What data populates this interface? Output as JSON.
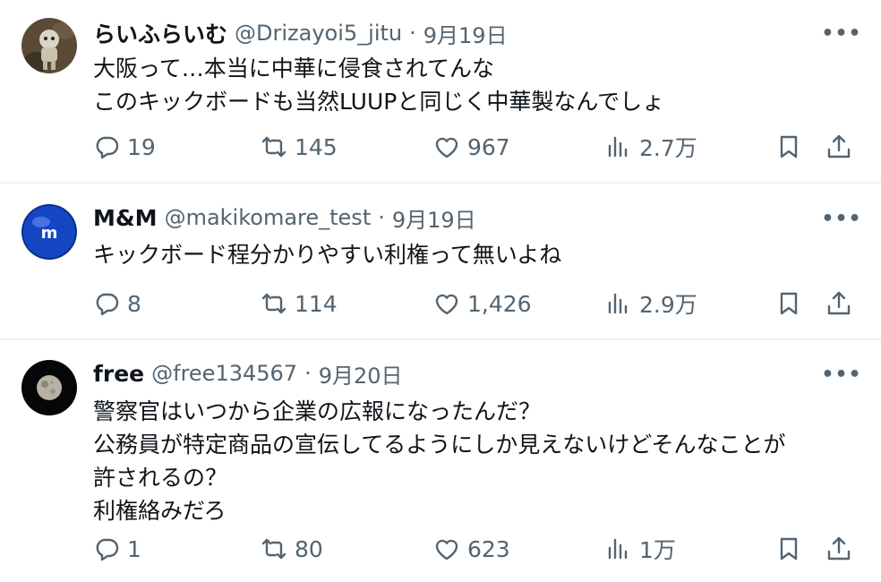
{
  "tweets": [
    {
      "display_name": "らいふらいむ",
      "handle": "@Drizayoi5_jitu",
      "date": "9月19日",
      "lines": [
        "大阪って…本当に中華に侵食されてんな",
        "このキックボードも当然LUUPと同じく中華製なんでしょ"
      ],
      "replies": "19",
      "retweets": "145",
      "likes": "967",
      "views": "2.7万"
    },
    {
      "display_name": "M&M",
      "handle": "@makikomare_test",
      "date": "9月19日",
      "lines": [
        "キックボード程分かりやすい利権って無いよね"
      ],
      "replies": "8",
      "retweets": "114",
      "likes": "1,426",
      "views": "2.9万"
    },
    {
      "display_name": "free",
      "handle": "@free134567",
      "date": "9月20日",
      "lines": [
        "警察官はいつから企業の広報になったんだ？",
        "公務員が特定商品の宣伝してるようにしか見えないけどそんなことが",
        "許されるの？",
        "利権絡みだろ"
      ],
      "replies": "1",
      "retweets": "80",
      "likes": "623",
      "views": "1万"
    }
  ],
  "separator": "·",
  "more_label": "•••",
  "colors": {
    "text": "#0f1419",
    "secondary": "#536471",
    "divider": "#eff3f4"
  }
}
